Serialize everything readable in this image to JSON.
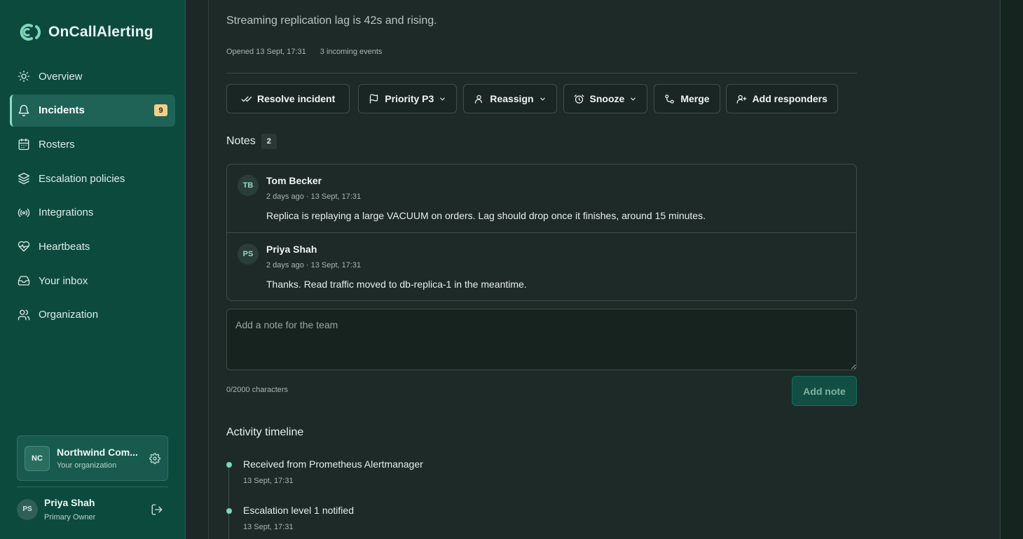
{
  "app": {
    "name": "OnCallAlerting"
  },
  "sidebar": {
    "items": [
      {
        "label": "Overview",
        "icon": "sun-icon"
      },
      {
        "label": "Incidents",
        "icon": "bell-icon",
        "badge": "9",
        "active": true
      },
      {
        "label": "Rosters",
        "icon": "calendar-icon"
      },
      {
        "label": "Escalation policies",
        "icon": "layers-icon"
      },
      {
        "label": "Integrations",
        "icon": "broadcast-icon"
      },
      {
        "label": "Heartbeats",
        "icon": "heart-pulse-icon"
      },
      {
        "label": "Your inbox",
        "icon": "inbox-icon"
      },
      {
        "label": "Organization",
        "icon": "users-icon"
      }
    ],
    "org": {
      "initials": "NC",
      "name": "Northwind Com...",
      "subtitle": "Your organization"
    },
    "user": {
      "initials": "PS",
      "name": "Priya Shah",
      "role": "Primary Owner"
    }
  },
  "incident": {
    "description": "Streaming replication lag is 42s and rising.",
    "opened": "Opened 13 Sept, 17:31",
    "events": "3 incoming events"
  },
  "actions": {
    "resolve": "Resolve incident",
    "priority": "Priority P3",
    "reassign": "Reassign",
    "snooze": "Snooze",
    "merge": "Merge",
    "add_responders": "Add responders"
  },
  "notes": {
    "title": "Notes",
    "count": "2",
    "items": [
      {
        "initials": "TB",
        "author": "Tom Becker",
        "time": "2 days ago · 13 Sept, 17:31",
        "body": "Replica is replaying a large VACUUM on orders. Lag should drop once it finishes, around 15 minutes."
      },
      {
        "initials": "PS",
        "author": "Priya Shah",
        "time": "2 days ago · 13 Sept, 17:31",
        "body": "Thanks. Read traffic moved to db-replica-1 in the meantime."
      }
    ],
    "placeholder": "Add a note for the team",
    "char_count": "0/2000 characters",
    "add_button": "Add note"
  },
  "timeline": {
    "title": "Activity timeline",
    "items": [
      {
        "label": "Received from Prometheus Alertmanager",
        "time": "13 Sept, 17:31"
      },
      {
        "label": "Escalation level 1 notified",
        "time": "13 Sept, 17:31"
      }
    ]
  },
  "colors": {
    "sidebar": "#0d4a3e",
    "accent": "#8fdcc0",
    "badge": "#f2d08a",
    "background": "#1c2826"
  }
}
